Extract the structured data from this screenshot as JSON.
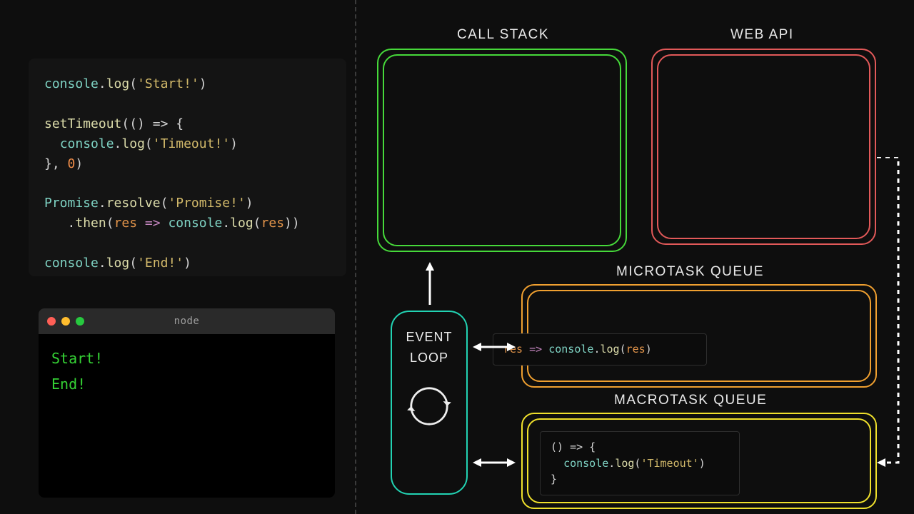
{
  "labels": {
    "call_stack": "CALL STACK",
    "web_api": "WEB API",
    "microtask_queue": "MICROTASK QUEUE",
    "macrotask_queue": "MACROTASK QUEUE",
    "event_loop_1": "EVENT",
    "event_loop_2": "LOOP"
  },
  "code": {
    "l1_console": "console",
    "l1_log": "log",
    "l1_str": "'Start!'",
    "l3_fn": "setTimeout",
    "l3_arrow": "() => {",
    "l4_console": "console",
    "l4_log": "log",
    "l4_str": "'Timeout!'",
    "l5_close": "}, ",
    "l5_num": "0",
    "l5_end": ")",
    "l7_promise": "Promise",
    "l7_resolve": "resolve",
    "l7_str": "'Promise!'",
    "l8_then": "then",
    "l8_arg1": "res",
    "l8_arrow": "=>",
    "l8_console": "console",
    "l8_log": "log",
    "l8_arg2": "res",
    "l10_console": "console",
    "l10_log": "log",
    "l10_str": "'End!'"
  },
  "terminal": {
    "title": "node",
    "lines": [
      "Start!",
      "End!"
    ]
  },
  "microtask_chip": {
    "arg1": "res",
    "arrow": "=>",
    "console": "console",
    "log": "log",
    "arg2": "res"
  },
  "macrotask_chip": {
    "open": "() => {",
    "console": "console",
    "log": "log",
    "str": "'Timeout'",
    "close": "}"
  },
  "colors": {
    "call_stack": "#46d93a",
    "web_api": "#e25959",
    "microtask": "#f0a030",
    "macrotask": "#f0e02c",
    "event_loop": "#22d3b3"
  }
}
